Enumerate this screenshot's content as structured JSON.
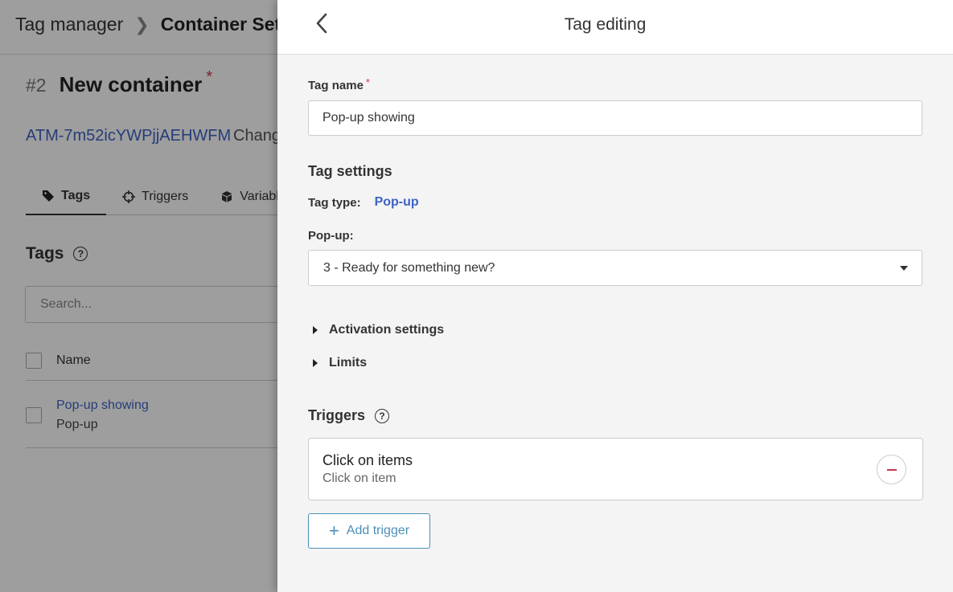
{
  "background": {
    "breadcrumb": {
      "root": "Tag manager",
      "current": "Container Setu"
    },
    "container": {
      "number": "#2",
      "name": "New container",
      "required_mark": "*",
      "id": "ATM-7m52icYWPjjAEHWFM",
      "change_link": "Chang"
    },
    "tabs": [
      {
        "label": "Tags",
        "icon": "tag-icon",
        "active": true
      },
      {
        "label": "Triggers",
        "icon": "crosshair-icon",
        "active": false
      },
      {
        "label": "Variabl",
        "icon": "cube-icon",
        "active": false
      }
    ],
    "tags_section": {
      "title": "Tags",
      "help": "?",
      "search_placeholder": "Search...",
      "column_name": "Name"
    },
    "rows": [
      {
        "name": "Pop-up showing",
        "type": "Pop-up"
      }
    ]
  },
  "drawer": {
    "title": "Tag editing",
    "tag_name": {
      "label": "Tag name",
      "required_mark": "*",
      "value": "Pop-up showing"
    },
    "tag_settings": {
      "title": "Tag settings",
      "tag_type_label": "Tag type:",
      "tag_type_value": "Pop-up",
      "popup_label": "Pop-up:",
      "popup_selected": "3 - Ready for something new?"
    },
    "expanders": [
      {
        "label": "Activation settings"
      },
      {
        "label": "Limits"
      }
    ],
    "triggers": {
      "title": "Triggers",
      "help": "?",
      "items": [
        {
          "name": "Click on items",
          "subtitle": "Click on item"
        }
      ],
      "add_label": "Add trigger"
    }
  },
  "colors": {
    "accent": "#3d63c4",
    "required": "#d0334a",
    "button_border": "#4a90b8",
    "overlay": "rgba(0,0,0,0.38)"
  }
}
